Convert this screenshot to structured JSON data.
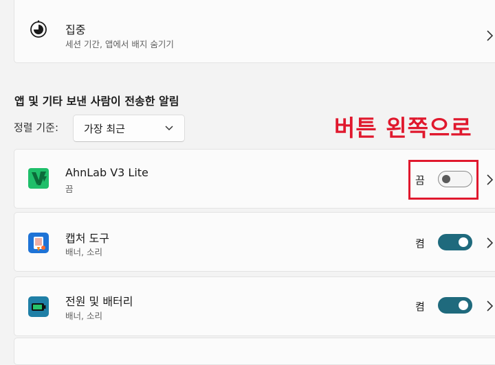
{
  "focus_row": {
    "title": "집중",
    "subtitle": "세션 기간, 앱에서 배지 숨기기",
    "icon": "focus-clock-icon"
  },
  "section": {
    "heading": "앱 및 기타 보낸 사람이 전송한 알림"
  },
  "sort": {
    "label": "정렬 기준:",
    "value": "가장 최근"
  },
  "annotation": {
    "text": "버튼 왼쪽으로",
    "color": "#e0182d"
  },
  "apps": [
    {
      "name": "AhnLab V3 Lite",
      "subtitle": "끔",
      "state_label": "끔",
      "enabled": false,
      "icon": "ahnlab-v3-icon"
    },
    {
      "name": "캡처 도구",
      "subtitle": "배너, 소리",
      "state_label": "켬",
      "enabled": true,
      "icon": "snipping-tool-icon"
    },
    {
      "name": "전원 및 배터리",
      "subtitle": "배너, 소리",
      "state_label": "켬",
      "enabled": true,
      "icon": "battery-icon"
    }
  ],
  "colors": {
    "toggle_on": "#1f6a7d",
    "toggle_off_knob": "#5a5a5a",
    "ahnlab_green": "#1fbf6a",
    "highlight": "#e0182d"
  }
}
